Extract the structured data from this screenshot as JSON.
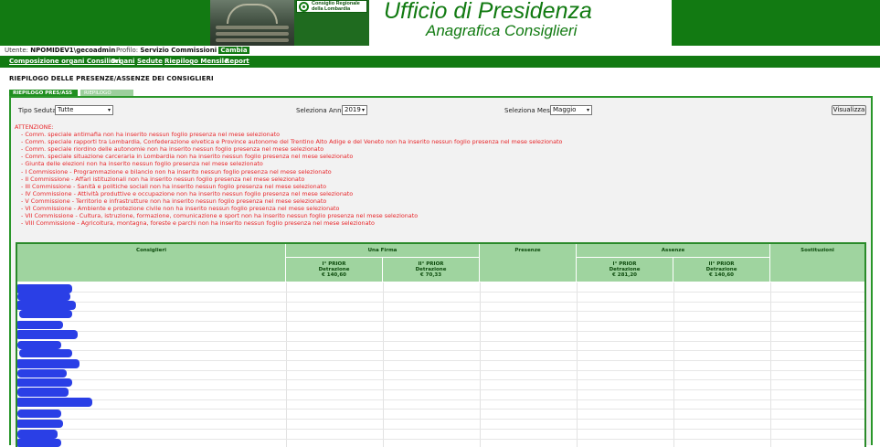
{
  "header": {
    "title": "Ufficio di Presidenza",
    "subtitle": "Anagrafica Consiglieri",
    "logo_text": "Consiglio Regionale della Lombardia"
  },
  "userbar": {
    "user_label": "Utente:",
    "user_value": "NPOMIDEV1\\gecoadmin",
    "profile_label": "Profilo:",
    "profile_value": "Servizio Commissioni",
    "change_label": "Cambia"
  },
  "menu": [
    {
      "label": "Composizione organi Consiliari"
    },
    {
      "label": "Organi"
    },
    {
      "label": "Sedute"
    },
    {
      "label": "Riepilogo Mensile"
    },
    {
      "label": "Report"
    }
  ],
  "page_title": "RIEPILOGO DELLE PRESENZE/ASSENZE DEI CONSIGLIERI",
  "tabs": [
    {
      "label": "RIEPILOGO PRES/ASS",
      "active": true
    },
    {
      "label": "RIEPILOGO SEDUTE",
      "active": false
    }
  ],
  "filters": {
    "tipo_label": "Tipo Seduta:",
    "tipo_value": "Tutte",
    "anno_label": "Seleziona Anno:",
    "anno_value": "2019",
    "mese_label": "Seleziona Mese:",
    "mese_value": "Maggio",
    "button_label": "Visualizza"
  },
  "warnings": {
    "header": "ATTENZIONE:",
    "items": [
      "- Comm. speciale antimafia non ha inserito nessun foglio presenza nel mese selezionato",
      "- Comm. speciale rapporti tra Lombardia, Confederazione elvetica e Province autonome del Trentino Alto Adige e del Veneto non ha inserito nessun foglio presenza nel mese selezionato",
      "- Comm. speciale riordino delle autonomie non ha inserito nessun foglio presenza nel mese selezionato",
      "- Comm. speciale situazione carceraria in Lombardia non ha inserito nessun foglio presenza nel mese selezionato",
      "- Giunta delle elezioni non ha inserito nessun foglio presenza nel mese selezionato",
      "- I Commissione - Programmazione e bilancio non ha inserito nessun foglio presenza nel mese selezionato",
      "- II Commissione - Affari istituzionali non ha inserito nessun foglio presenza nel mese selezionato",
      "- III Commissione - Sanità e politiche sociali non ha inserito nessun foglio presenza nel mese selezionato",
      "- IV Commissione - Attività produttive e occupazione non ha inserito nessun foglio presenza nel mese selezionato",
      "- V Commissione - Territorio e infrastrutture non ha inserito nessun foglio presenza nel mese selezionato",
      "- VI Commissione - Ambiente e protezione civile non ha inserito nessun foglio presenza nel mese selezionato",
      "- VII Commissione - Cultura, istruzione, formazione, comunicazione e sport non ha inserito nessun foglio presenza nel mese selezionato",
      "- VIII Commissione - Agricoltura, montagna, foreste e parchi non ha inserito nessun foglio presenza nel mese selezionato"
    ]
  },
  "table": {
    "headers": {
      "consiglieri": "Consiglieri",
      "una_firma": "Una Firma",
      "presenze": "Presenze",
      "assenze": "Assenze",
      "sostituzioni": "Sostituzioni"
    },
    "sub_headers": [
      {
        "prior": "I° PRIOR",
        "detr": "Detrazione",
        "amount": "€ 140,60"
      },
      {
        "prior": "II° PRIOR",
        "detr": "Detrazione",
        "amount": "€ 70,33"
      },
      {
        "prior": "I° PRIOR",
        "detr": "Detrazione",
        "amount": "€ 281,20"
      },
      {
        "prior": "II° PRIOR",
        "detr": "Detrazione",
        "amount": "€ 140,60"
      }
    ]
  },
  "colors": {
    "brand_green": "#127a12",
    "header_cell": "#9fd49f",
    "warning_red": "#e8262a",
    "redaction": "#2a3fe6"
  }
}
